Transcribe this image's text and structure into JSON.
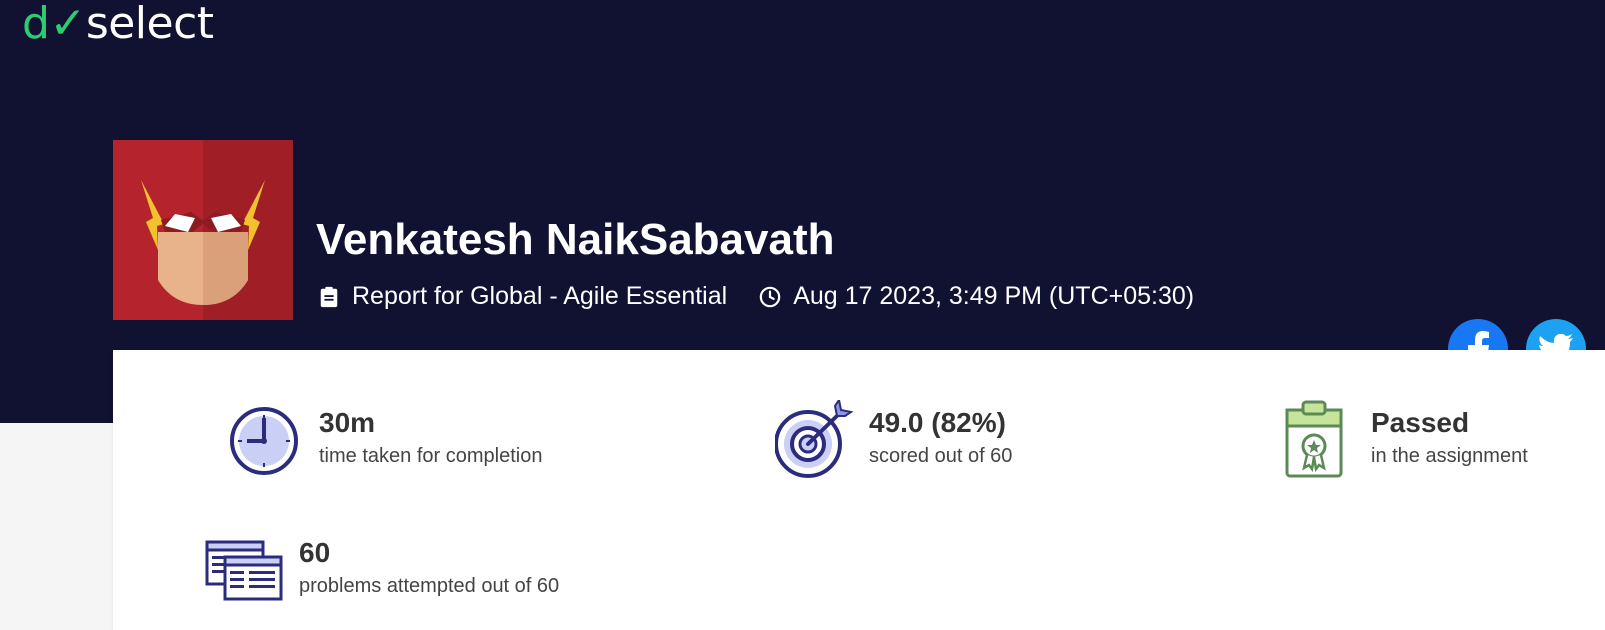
{
  "brand": {
    "logo_prefix": "d",
    "logo_check": "✓",
    "logo_rest": "select"
  },
  "user": {
    "name": "Venkatesh NaikSabavath"
  },
  "report": {
    "title": "Report for Global - Agile Essential",
    "date": "Aug 17 2023, 3:49 PM (UTC+05:30)"
  },
  "stats": [
    {
      "value": "30m",
      "label": "time taken for completion",
      "icon": "clock-icon"
    },
    {
      "value": "49.0 (82%)",
      "label": "scored out of 60",
      "icon": "target-icon"
    },
    {
      "value": "Passed",
      "label": "in the assignment",
      "icon": "certificate-icon"
    },
    {
      "value": "60",
      "label": "problems attempted out of 60",
      "icon": "windows-icon"
    }
  ],
  "social": [
    {
      "name": "facebook"
    },
    {
      "name": "twitter"
    }
  ],
  "colors": {
    "hero_bg": "#111132",
    "brand_green": "#2ecc71",
    "icon_navy": "#2b2d7c",
    "icon_fill": "#c9cff5",
    "pass_green": "#5b8a57"
  }
}
